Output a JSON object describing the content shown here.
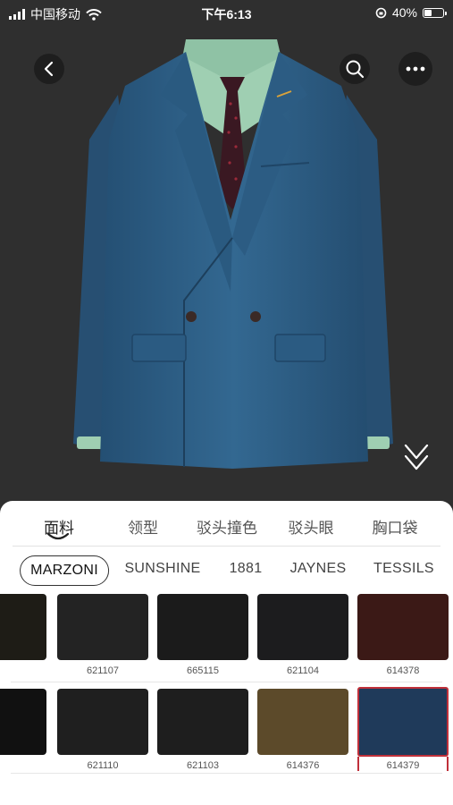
{
  "status_bar": {
    "carrier": "中国移动",
    "time": "下午6:13",
    "battery": "40%",
    "battery_level": 0.4
  },
  "tabs": [
    {
      "label": "面料",
      "active": true
    },
    {
      "label": "领型",
      "active": false
    },
    {
      "label": "驳头撞色",
      "active": false
    },
    {
      "label": "驳头眼",
      "active": false
    },
    {
      "label": "胸口袋",
      "active": false
    }
  ],
  "brands": [
    {
      "label": "MARZONI",
      "active": true
    },
    {
      "label": "SUNSHINE",
      "active": false
    },
    {
      "label": "1881",
      "active": false
    },
    {
      "label": "JAYNES",
      "active": false
    },
    {
      "label": "TESSILS",
      "active": false
    }
  ],
  "fabrics": {
    "row1": [
      {
        "code": "",
        "color": "#1e1c16"
      },
      {
        "code": "621107",
        "color": "#232323"
      },
      {
        "code": "665115",
        "color": "#1b1b1b"
      },
      {
        "code": "621104",
        "color": "#1c1c1e"
      },
      {
        "code": "614378",
        "color": "#3b1916"
      }
    ],
    "row2": [
      {
        "code": "",
        "color": "#111111"
      },
      {
        "code": "621110",
        "color": "#1f1f1f"
      },
      {
        "code": "621103",
        "color": "#1e1e1e"
      },
      {
        "code": "614376",
        "color": "#5c4a2a"
      },
      {
        "code": "614379",
        "color": "#1f3a5a",
        "selected": true
      }
    ]
  },
  "colors": {
    "suit": "#2f5f86",
    "shirt": "#9fcfb2",
    "tie": "#3a1822",
    "accent": "#c0303a"
  },
  "icons": {
    "back": "back-arrow-icon",
    "search": "search-icon",
    "more": "more-dots-icon",
    "collapse": "double-chevron-down-icon"
  }
}
